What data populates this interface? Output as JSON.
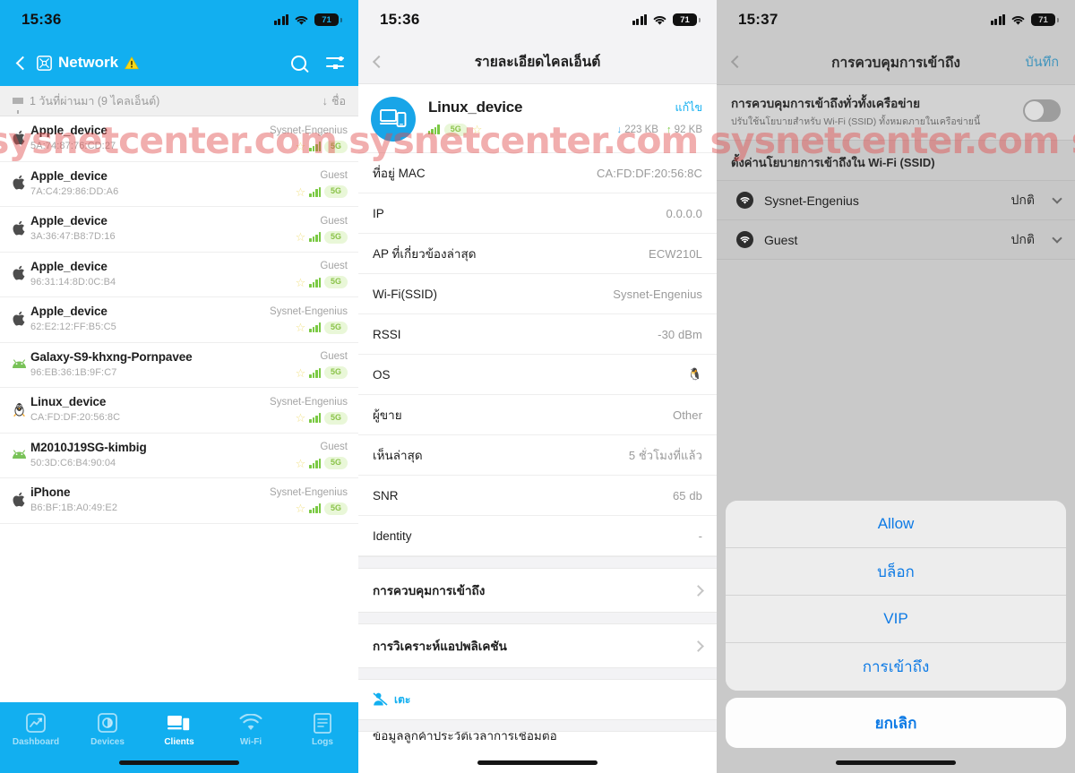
{
  "watermark": {
    "text": "sysnetcenter.com   sysnetcenter.com   sysnetcenter.com   sysn",
    "color": "#e14e4e"
  },
  "panel1": {
    "statusbar": {
      "time": "15:36",
      "battery": "71",
      "cell_icon": "cellular-icon",
      "wifi_icon": "wifi-icon"
    },
    "navbar": {
      "back_icon": "back-chevron-icon",
      "network_icon": "network-icon",
      "title": "Network",
      "warning_icon": "warning-icon",
      "search_icon": "search-icon",
      "filter_icon": "filter-settings-icon"
    },
    "filterbar": {
      "funnel_icon": "funnel-icon",
      "text": "1 วันที่ผ่านมา (9 ไคลเอ็นต์)",
      "sort_arrow": "↓",
      "sort_label": "ชื่อ"
    },
    "clients": [
      {
        "os": "apple",
        "name": "Apple_device",
        "mac": "5A:74:87:76:CD:27",
        "ssid": "Sysnet-Engenius",
        "band": "5G",
        "starred": false
      },
      {
        "os": "apple",
        "name": "Apple_device",
        "mac": "7A:C4:29:86:DD:A6",
        "ssid": "Guest",
        "band": "5G",
        "starred": false
      },
      {
        "os": "apple",
        "name": "Apple_device",
        "mac": "3A:36:47:B8:7D:16",
        "ssid": "Guest",
        "band": "5G",
        "starred": false
      },
      {
        "os": "apple",
        "name": "Apple_device",
        "mac": "96:31:14:8D:0C:B4",
        "ssid": "Guest",
        "band": "5G",
        "starred": false
      },
      {
        "os": "apple",
        "name": "Apple_device",
        "mac": "62:E2:12:FF:B5:C5",
        "ssid": "Sysnet-Engenius",
        "band": "5G",
        "starred": false
      },
      {
        "os": "android",
        "name": "Galaxy-S9-khxng-Pornpavee",
        "mac": "96:EB:36:1B:9F:C7",
        "ssid": "Guest",
        "band": "5G",
        "starred": false
      },
      {
        "os": "linux",
        "name": "Linux_device",
        "mac": "CA:FD:DF:20:56:8C",
        "ssid": "Sysnet-Engenius",
        "band": "5G",
        "starred": false
      },
      {
        "os": "android",
        "name": "M2010J19SG-kimbig",
        "mac": "50:3D:C6:B4:90:04",
        "ssid": "Guest",
        "band": "5G",
        "starred": false
      },
      {
        "os": "apple",
        "name": "iPhone",
        "mac": "B6:BF:1B:A0:49:E2",
        "ssid": "Sysnet-Engenius",
        "band": "5G",
        "starred": false
      }
    ],
    "tabs": [
      {
        "label": "Dashboard",
        "icon": "dashboard-icon",
        "active": false
      },
      {
        "label": "Devices",
        "icon": "devices-icon",
        "active": false
      },
      {
        "label": "Clients",
        "icon": "clients-icon",
        "active": true
      },
      {
        "label": "Wi-Fi",
        "icon": "wifi-icon",
        "active": false
      },
      {
        "label": "Logs",
        "icon": "logs-icon",
        "active": false
      }
    ]
  },
  "panel2": {
    "statusbar": {
      "time": "15:36",
      "battery": "71"
    },
    "navbar": {
      "back_icon": "back-chevron-icon",
      "title": "รายละเอียดไคลเอ็นต์"
    },
    "device": {
      "avatar_icon": "client-devices-icon",
      "name": "Linux_device",
      "edit_label": "แก้ไข",
      "band": "5G",
      "download": "223 KB",
      "upload": "92 KB",
      "down_arrow": "↓",
      "up_arrow": "↑"
    },
    "details": [
      {
        "key": "ที่อยู่ MAC",
        "value": "CA:FD:DF:20:56:8C"
      },
      {
        "key": "IP",
        "value": "0.0.0.0"
      },
      {
        "key": "AP ที่เกี่ยวข้องล่าสุด",
        "value": "ECW210L"
      },
      {
        "key": "Wi-Fi(SSID)",
        "value": "Sysnet-Engenius"
      },
      {
        "key": "RSSI",
        "value": "-30 dBm"
      },
      {
        "key": "OS",
        "value": "🐧"
      },
      {
        "key": "ผู้ขาย",
        "value": "Other"
      },
      {
        "key": "เห็นล่าสุด",
        "value": "5 ชั่วโมงที่แล้ว"
      },
      {
        "key": "SNR",
        "value": "65 db"
      },
      {
        "key": "Identity",
        "value": "-"
      }
    ],
    "menu": [
      {
        "label": "การควบคุมการเข้าถึง",
        "chevron": "chevron-right-icon"
      },
      {
        "label": "การวิเคราะห์แอปพลิเคชัน",
        "chevron": "chevron-right-icon"
      }
    ],
    "kick": {
      "icon": "kick-user-icon",
      "label": "เตะ"
    },
    "cut_row_text": "ข้อมูลลูกค้าประวัติเวลาการเชื่อมต่อ"
  },
  "panel3": {
    "statusbar": {
      "time": "15:37",
      "battery": "71"
    },
    "navbar": {
      "back_icon": "back-chevron-icon",
      "title": "การควบคุมการเข้าถึง",
      "save_label": "บันทึก"
    },
    "network_toggle": {
      "title": "การควบคุมการเข้าถึงทั่วทั้งเครือข่าย",
      "desc": "ปรับใช้นโยบายสำหรับ Wi-Fi (SSID) ทั้งหมดภายในเครือข่ายนี้",
      "on": false
    },
    "section_header": "ตั้งค่านโยบายการเข้าถึงใน Wi-Fi (SSID)",
    "ssids": [
      {
        "icon": "wifi-circle-icon",
        "name": "Sysnet-Engenius",
        "state": "ปกติ",
        "chevron": "chevron-down-icon"
      },
      {
        "icon": "wifi-circle-icon",
        "name": "Guest",
        "state": "ปกติ",
        "chevron": "chevron-down-icon"
      }
    ],
    "action_sheet": {
      "options": [
        "Allow",
        "บล็อก",
        "VIP",
        "การเข้าถึง"
      ],
      "cancel": "ยกเลิก"
    }
  }
}
